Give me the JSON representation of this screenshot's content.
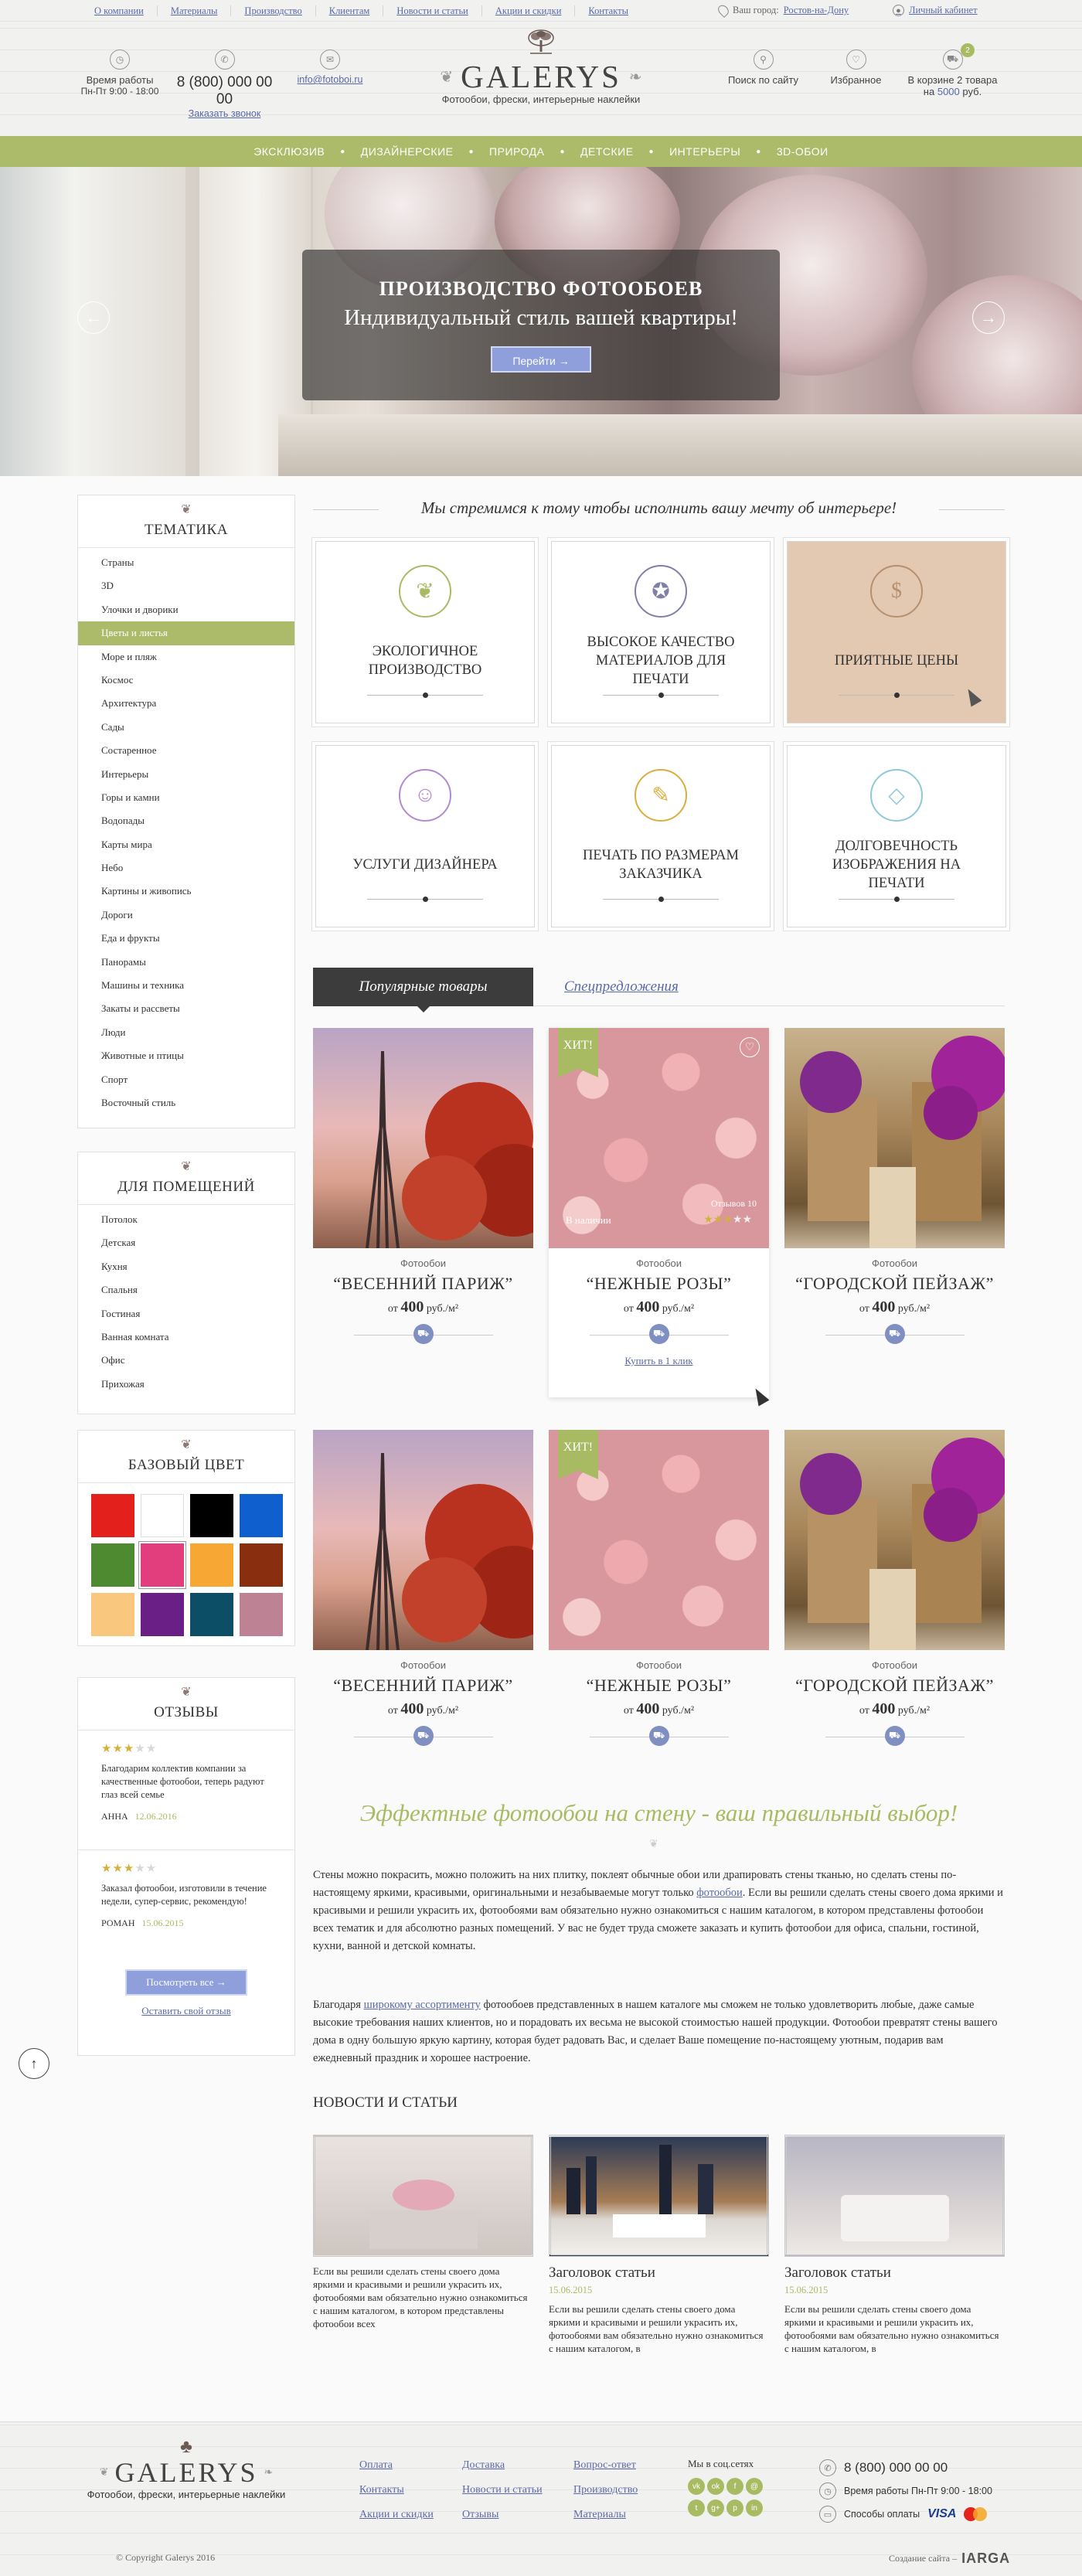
{
  "topbar": {
    "nav": [
      "О компании",
      "Материалы",
      "Производство",
      "Клиентам",
      "Новости и статьи",
      "Акции и скидки",
      "Контакты"
    ],
    "city_label": "Ваш город:",
    "city_value": "Ростов-на-Дону",
    "cabinet": "Личный кабинет"
  },
  "header": {
    "work_label": "Время работы",
    "work_hours": "Пн-Пт 9:00 - 18:00",
    "phone": "8 (800) 000 00 00",
    "callback": "Заказать звонок",
    "email": "info@fotoboi.ru",
    "logo": "GALERYS",
    "tagline": "Фотообои, фрески, интерьерные наклейки",
    "search": "Поиск по сайту",
    "favorites": "Избранное",
    "cart_count": "2",
    "cart_line1": "В корзине 2 товара",
    "cart_line2_prefix": "на",
    "cart_sum": "5000",
    "cart_line2_suffix": "руб."
  },
  "green_menu": [
    "ЭКСКЛЮЗИВ",
    "ДИЗАЙНЕРСКИЕ",
    "ПРИРОДА",
    "ДЕТСКИЕ",
    "ИНТЕРЬЕРЫ",
    "3D-ОБОИ"
  ],
  "hero": {
    "title": "ПРОИЗВОДСТВО ФОТООБОЕВ",
    "subtitle": "Индивидуальный стиль вашей квартиры!",
    "button": "Перейти"
  },
  "sidebar": {
    "themes_title": "ТЕМАТИКА",
    "themes": [
      "Страны",
      "3D",
      "Улочки и дворики",
      "Цветы и листья",
      "Море и пляж",
      "Космос",
      "Архитектура",
      "Сады",
      "Состаренное",
      "Интерьеры",
      "Горы и камни",
      "Водопады",
      "Карты мира",
      "Небо",
      "Картины и живопись",
      "Дороги",
      "Еда и фрукты",
      "Панорамы",
      "Машины и техника",
      "Закаты и рассветы",
      "Люди",
      "Животные и птицы",
      "Спорт",
      "Восточный стиль"
    ],
    "rooms_title": "ДЛЯ ПОМЕЩЕНИЙ",
    "rooms": [
      "Потолок",
      "Детская",
      "Кухня",
      "Спальня",
      "Гостиная",
      "Ванная комната",
      "Офис",
      "Прихожая"
    ],
    "colors_title": "БАЗОВЫЙ ЦВЕТ",
    "colors": [
      "#e3201b",
      "#ffffff",
      "#000000",
      "#0f5fcf",
      "#4e8a2f",
      "#e23d7c",
      "#f7a733",
      "#8a2e10",
      "#f9c77e",
      "#6a1f86",
      "#0b4e66",
      "#bd8294"
    ],
    "reviews_title": "ОТЗЫВЫ",
    "reviews": [
      {
        "text": "Благодарим коллектив компании за качественные фотообои, теперь радуют глаз всей семье",
        "author": "АННА",
        "date": "12.06.2016"
      },
      {
        "text": "Заказал фотообои, изготовили в течение недели, супер-сервис, рекомендую!",
        "author": "РОМАН",
        "date": "15.06.2015"
      }
    ],
    "all_reviews": "Посмотреть все",
    "leave_review": "Оставить свой отзыв"
  },
  "slogan": "Мы стремимся к тому чтобы исполнить вашу мечту об интерьере!",
  "features": [
    {
      "label": "ЭКОЛОГИЧНОЕ ПРОИЗВОДСТВО",
      "icon": "leaf-icon"
    },
    {
      "label": "ВЫСОКОЕ КАЧЕСТВО МАТЕРИАЛОВ ДЛЯ ПЕЧАТИ",
      "icon": "medal-icon"
    },
    {
      "label": "ПРИЯТНЫЕ ЦЕНЫ",
      "icon": "money-bag-icon"
    },
    {
      "label": "УСЛУГИ ДИЗАЙНЕРА",
      "icon": "designer-icon"
    },
    {
      "label": "ПЕЧАТЬ ПО РАЗМЕРАМ ЗАКАЗЧИКА",
      "icon": "tools-icon"
    },
    {
      "label": "ДОЛГОВЕЧНОСТЬ ИЗОБРАЖЕНИЯ НА ПЕЧАТИ",
      "icon": "diamond-icon"
    }
  ],
  "tabs": {
    "popular": "Популярные товары",
    "special": "Спецпредложения"
  },
  "products": [
    {
      "cat": "Фотообои",
      "name": "“ВЕСЕННИЙ ПАРИЖ”",
      "from": "от",
      "price": "400",
      "unit": "руб./м²"
    },
    {
      "cat": "Фотообои",
      "name": "“НЕЖНЫЕ РОЗЫ”",
      "from": "от",
      "price": "400",
      "unit": "руб./м²",
      "hit": "ХИТ!",
      "stock": "В наличии",
      "reviews": "Отзывов 10",
      "buy": "Купить в 1 клик"
    },
    {
      "cat": "Фотообои",
      "name": "“ГОРОДСКОЙ ПЕЙЗАЖ”",
      "from": "от",
      "price": "400",
      "unit": "руб./м²"
    },
    {
      "cat": "Фотообои",
      "name": "“ВЕСЕННИЙ ПАРИЖ”",
      "from": "от",
      "price": "400",
      "unit": "руб./м²"
    },
    {
      "cat": "Фотообои",
      "name": "“НЕЖНЫЕ РОЗЫ”",
      "from": "от",
      "price": "400",
      "unit": "руб./м²",
      "hit": "ХИТ!"
    },
    {
      "cat": "Фотообои",
      "name": "“ГОРОДСКОЙ ПЕЙЗАЖ”",
      "from": "от",
      "price": "400",
      "unit": "руб./м²"
    }
  ],
  "seo": {
    "title": "Эффектные фотообои на стену - ваш правильный выбор!",
    "p1a": "Стены можно покрасить, можно положить на них плитку, поклеят обычные обои или драпировать стены тканью, но сделать стены по-настоящему яркими, красивыми, оригинальными и незабываемые могут только ",
    "p1link": "фотообои",
    "p1b": ". Если вы решили сделать стены своего дома яркими и красивыми и решили украсить их, фотообоями вам обязательно нужно ознакомиться с нашим каталогом, в котором представлены фотообои всех тематик и для абсолютно разных помещений. У вас не будет труда сможете заказать и купить фотообои для офиса, спальни, гостиной, кухни, ванной и детской комнаты.",
    "p2a": "Благодаря ",
    "p2link": "широкому ассортименту",
    "p2b": " фотообоев представленных в нашем каталоге мы сможем не только удовлетворить любые, даже самые высокие требования наших клиентов, но и порадовать их весьма не высокой стоимостью нашей продукции. Фотообои превратят стены вашего дома в одну большую яркую картину, которая будет радовать Вас, и сделает Ваше помещение по-настоящему уютным, подарив вам ежедневный праздник и хорошее настроение."
  },
  "news": {
    "title": "НОВОСТИ И СТАТЬИ",
    "items": [
      {
        "title": "",
        "date": "",
        "text": "Если вы решили сделать стены своего дома яркими и красивыми и решили украсить их, фотообоями вам обязательно нужно ознакомиться с нашим каталогом, в котором представлены фотообои всех"
      },
      {
        "title": "Заголовок статьи",
        "date": "15.06.2015",
        "text": "Если вы решили сделать стены своего дома яркими и красивыми и решили украсить их, фотообоями вам обязательно нужно ознакомиться с нашим каталогом, в"
      },
      {
        "title": "Заголовок статьи",
        "date": "15.06.2015",
        "text": "Если вы решили сделать стены своего дома яркими и красивыми и решили украсить их, фотообоями вам обязательно нужно ознакомиться с нашим каталогом, в"
      }
    ]
  },
  "footer": {
    "logo": "GALERYS",
    "tagline": "Фотообои, фрески, интерьерные наклейки",
    "col1": [
      "Оплата",
      "Контакты",
      "Акции и скидки"
    ],
    "col2": [
      "Доставка",
      "Новости и статьи",
      "Отзывы"
    ],
    "col3": [
      "Вопрос-ответ",
      "Производство",
      "Материалы"
    ],
    "social_label": "Мы в соц.сетях",
    "phone": "8 (800) 000 00 00",
    "hours": "Время работы Пн-Пт 9:00 - 18:00",
    "payment": "Способы оплаты",
    "visa": "VISA",
    "copyright": "© Copyright Galerys 2016",
    "made_by": "Создание сайта –",
    "studio": "IARGA"
  },
  "colors": {
    "accent_green": "#acbb6a",
    "link_blue": "#5a6aa8",
    "button_blue": "#8e9fdc"
  }
}
